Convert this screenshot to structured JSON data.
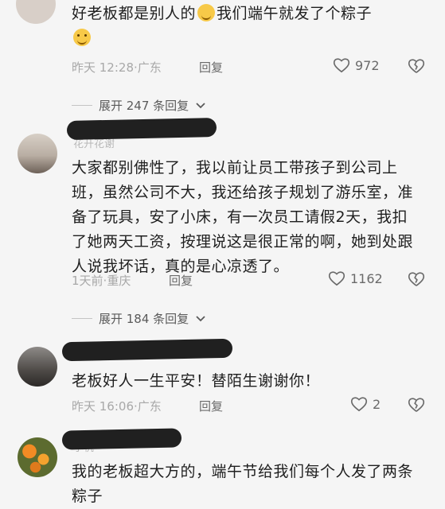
{
  "comments": [
    {
      "text_parts": [
        "好老板都是别人的",
        "我们端午就发了个粽子"
      ],
      "time": "昨天 12:28",
      "location": "广东",
      "reply_label": "回复",
      "likes": "972"
    },
    {
      "username_faint": "花开花谢",
      "text": "大家都别佛性了，我以前让员工带孩子到公司上班，虽然公司不大，我还给孩子规划了游乐室，准备了玩具，安了小床，有一次员工请假2天，我扣了她两天工资，按理说这是很正常的啊，她到处跟人说我坏话，真的是心凉透了。",
      "time": "1天前",
      "location": "重庆",
      "reply_label": "回复",
      "likes": "1162"
    },
    {
      "text": "老板好人一生平安！替陌生谢谢你！",
      "time": "昨天 16:06",
      "location": "广东",
      "reply_label": "回复",
      "likes": "2"
    },
    {
      "username_faint": "小杭",
      "text": "我的老板超大方的，端午节给我们每个人发了两条粽子"
    }
  ],
  "expand_1": "展开 247 条回复",
  "expand_2": "展开 184 条回复",
  "colors": {
    "background": "#f5f5f5",
    "text": "#1f1f1f",
    "meta": "#a8a8a8",
    "scribble": "#202020"
  }
}
